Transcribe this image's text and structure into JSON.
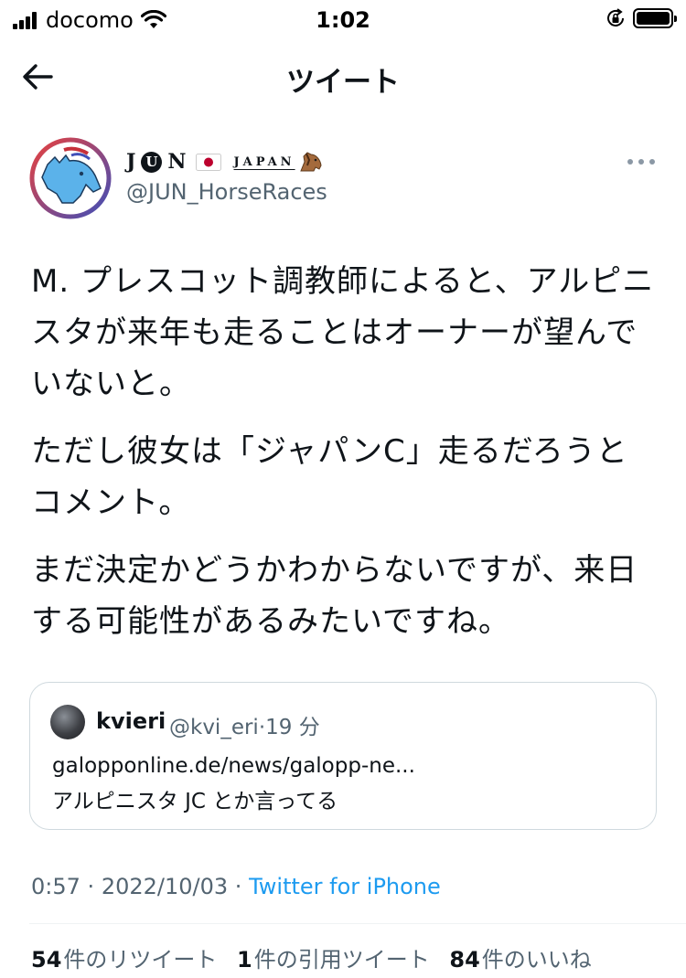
{
  "status_bar": {
    "carrier": "docomo",
    "time": "1:02"
  },
  "nav": {
    "title": "ツイート"
  },
  "author": {
    "name_j": "J",
    "name_u": "U",
    "name_n": "N",
    "name_japan": "JAPAN",
    "handle": "@JUN_HorseRaces"
  },
  "tweet": {
    "paragraphs": [
      "M. プレスコット調教師によると、アルピニスタが来年も走ることはオーナーが望んでいないと。",
      "ただし彼女は「ジャパンC」走るだろうとコメント。",
      "まだ決定かどうかわからないですが、来日する可能性があるみたいですね。"
    ]
  },
  "quote": {
    "name": "kvieri",
    "handle": "@kvi_eri",
    "separator": "·",
    "time_ago": "19 分",
    "link": "galopponline.de/news/galopp-ne...",
    "text": "アルピニスタ JC とか言ってる"
  },
  "meta": {
    "time": "0:57",
    "sep1": "·",
    "date": "2022/10/03",
    "sep2": "·",
    "source": "Twitter for iPhone"
  },
  "stats": {
    "retweets": "54",
    "retweets_label": "件のリツイート",
    "quotes": "1",
    "quotes_label": "件の引用ツイート",
    "likes": "84",
    "likes_label": "件のいいね"
  },
  "colors": {
    "accent": "#1d9bf0",
    "secondary_text": "#536471",
    "primary_text": "#0f1419",
    "border": "#cfd9de"
  },
  "icons": [
    "signal-icon",
    "wifi-icon",
    "orientation-lock-icon",
    "battery-icon",
    "back-arrow-icon",
    "japan-flag-icon",
    "horse-icon",
    "more-icon"
  ]
}
